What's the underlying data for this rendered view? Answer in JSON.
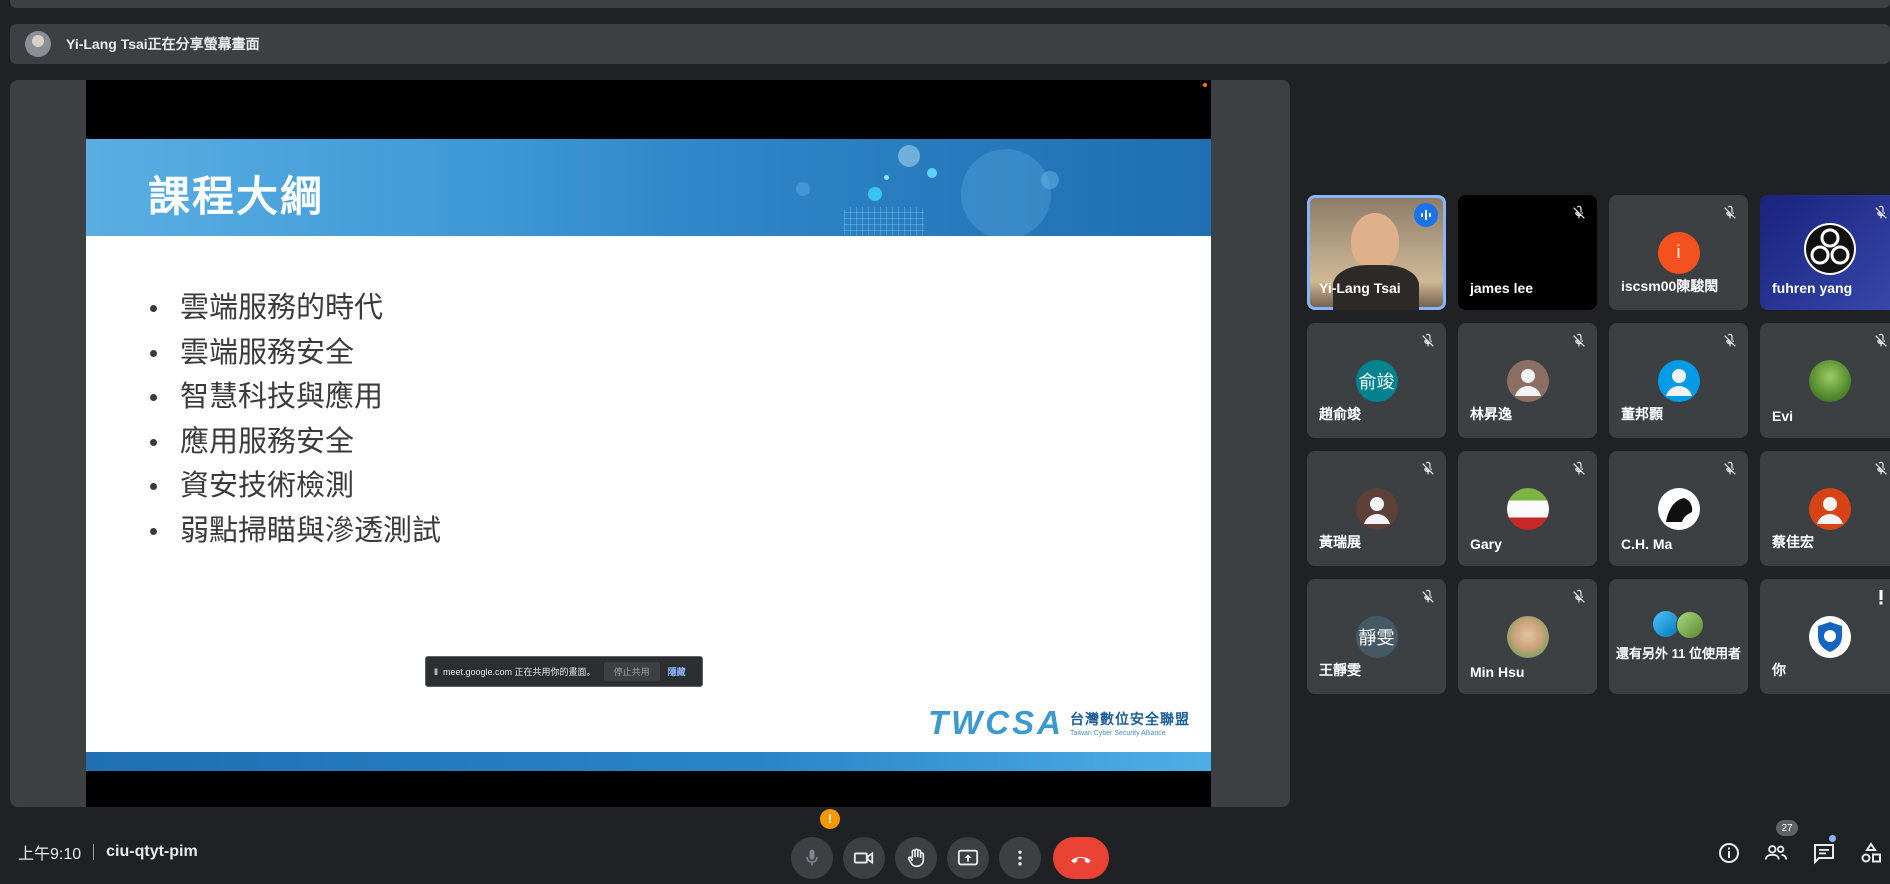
{
  "presenter_bar": {
    "text": "Yi-Lang Tsai正在分享螢幕畫面"
  },
  "slide": {
    "title": "課程大綱",
    "bullets": [
      "雲端服務的時代",
      "雲端服務安全",
      "智慧科技與應用",
      "應用服務安全",
      "資安技術檢測",
      "弱點掃瞄與滲透測試"
    ],
    "logo_mark": "TWCSA",
    "logo_zh": "台灣數位安全聯盟",
    "logo_en": "Taiwan Cyber Security Alliance"
  },
  "share_toast": {
    "pause": "II",
    "text": "meet.google.com 正在共用你的畫面。",
    "stop_label": "停止共用",
    "hide_label": "隱藏"
  },
  "participants": [
    {
      "name": "Yi-Lang Tsai",
      "kind": "video",
      "speaking": true
    },
    {
      "name": "james lee",
      "kind": "black",
      "muted": true
    },
    {
      "name": "iscsm00陳駿閎",
      "kind": "letter",
      "letter": "i",
      "color": "#f4511e",
      "muted": true
    },
    {
      "name": "fuhren yang",
      "kind": "obs",
      "muted": true
    },
    {
      "name": "趙俞竣",
      "kind": "letter",
      "letter": "俞竣",
      "color": "#00838f",
      "muted": true
    },
    {
      "name": "林昇逸",
      "kind": "person",
      "color": "#8d6e63",
      "muted": true
    },
    {
      "name": "董邦顥",
      "kind": "person",
      "color": "#039be5",
      "muted": true
    },
    {
      "name": "Evi",
      "kind": "photo-green",
      "muted": true
    },
    {
      "name": "黃瑞展",
      "kind": "person",
      "color": "#5d4037",
      "muted": true
    },
    {
      "name": "Gary",
      "kind": "photo-player",
      "muted": true
    },
    {
      "name": "C.H. Ma",
      "kind": "photo-panther",
      "muted": true
    },
    {
      "name": "蔡佳宏",
      "kind": "person",
      "color": "#d84315",
      "muted": true
    },
    {
      "name": "王靜雯",
      "kind": "letter",
      "letter": "靜雯",
      "color": "#455a64",
      "muted": true
    },
    {
      "name": "Min Hsu",
      "kind": "photo-face",
      "muted": true
    },
    {
      "name": "還有另外 11 位使用者",
      "kind": "more"
    },
    {
      "name": "你",
      "kind": "photo-badge",
      "alert": true
    }
  ],
  "bottom_bar": {
    "time": "上午9:10",
    "meeting_code": "ciu-qtyt-pim",
    "alert_mark": "!",
    "people_count": "27"
  },
  "colors": {
    "end_call": "#ea4335",
    "speaking": "#8ab4f8",
    "alert": "#f29900"
  }
}
